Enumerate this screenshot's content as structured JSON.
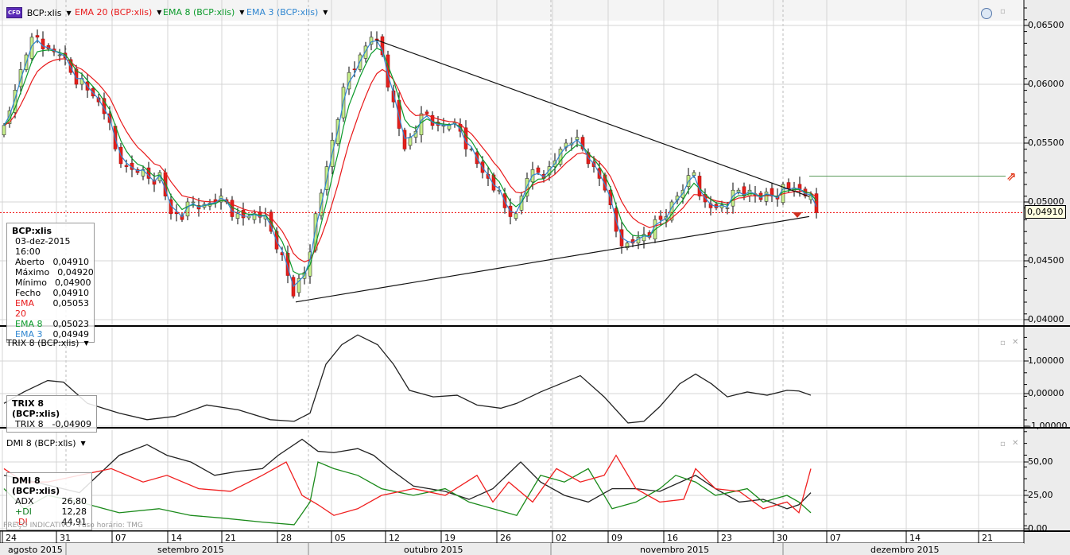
{
  "header": {
    "symbol_badge": "CFD",
    "symbol": "BCP:xlis",
    "indicators": [
      {
        "label": "EMA 20 (BCP:xlis)",
        "color": "#e8191a"
      },
      {
        "label": "EMA 8 (BCP:xlis)",
        "color": "#0a9a2a"
      },
      {
        "label": "EMA 3 (BCP:xlis)",
        "color": "#2f86d0"
      }
    ]
  },
  "info_box": {
    "title": "BCP:xlis",
    "datetime": "03-dez-2015 16:00",
    "rows": [
      {
        "label": "Aberto",
        "value": "0,04910",
        "color": "#000"
      },
      {
        "label": "Máximo",
        "value": "0,04920",
        "color": "#000"
      },
      {
        "label": "Mínimo",
        "value": "0,04900",
        "color": "#000"
      },
      {
        "label": "Fecho",
        "value": "0,04910",
        "color": "#000"
      },
      {
        "label": "EMA 20",
        "value": "0,05053",
        "color": "#e8191a"
      },
      {
        "label": "EMA 8",
        "value": "0,05023",
        "color": "#0a9a2a"
      },
      {
        "label": "EMA 3",
        "value": "0,04949",
        "color": "#2f86d0"
      }
    ]
  },
  "trix_panel": {
    "title": "TRIX 8 (BCP:xlis)",
    "box_title": "TRIX 8 (BCP:xlis)",
    "label": "TRIX 8",
    "value": "-0,04909"
  },
  "dmi_panel": {
    "title": "DMI 8 (BCP:xlis)",
    "box_title": "DMI 8 (BCP:xlis)",
    "rows": [
      {
        "label": "ADX",
        "value": "26,80",
        "color": "#000"
      },
      {
        "label": "+DI",
        "value": "12,28",
        "color": "#0a7a1a"
      },
      {
        "label": "-DI",
        "value": "44,91",
        "color": "#e8191a"
      }
    ]
  },
  "current_price_tag": "0,04910",
  "footer": {
    "indicative": "PREÇO INDICATIVO",
    "timezone": "Fuso horário: TMG"
  },
  "chart_data": [
    {
      "type": "candlestick",
      "title": "BCP:xlis",
      "x_unit": "days since 2015-08-24",
      "close_start_day": 0.2,
      "close_step_days": 1.4,
      "closes": [
        0.0565,
        0.0595,
        0.0625,
        0.064,
        0.063,
        0.0625,
        0.061,
        0.0605,
        0.059,
        0.0575,
        0.0545,
        0.053,
        0.0525,
        0.052,
        0.0525,
        0.049,
        0.0485,
        0.05,
        0.0498,
        0.05,
        0.05,
        0.049,
        0.0488,
        0.0487,
        0.0475,
        0.0455,
        0.042,
        0.044,
        0.049,
        0.053,
        0.057,
        0.061,
        0.0625,
        0.064,
        0.0625,
        0.0585,
        0.0545,
        0.056,
        0.0575,
        0.0565,
        0.0565,
        0.056,
        0.0545,
        0.0525,
        0.051,
        0.0495,
        0.049,
        0.052,
        0.0525,
        0.053,
        0.0545,
        0.055,
        0.0545,
        0.053,
        0.051,
        0.0475,
        0.0465,
        0.047,
        0.047,
        0.0485,
        0.05,
        0.051,
        0.0525,
        0.05,
        0.0495,
        0.0495,
        0.051,
        0.051,
        0.0502,
        0.0505,
        0.0515,
        0.0512,
        0.0505,
        0.0491
      ],
      "ylim": [
        0.0395,
        0.0675
      ],
      "y_ticks": [
        "0,04000",
        "0,04500",
        "0,05000",
        "0,05500",
        "0,06000",
        "0,06500"
      ],
      "y_tick_values": [
        0.04,
        0.045,
        0.05,
        0.055,
        0.06,
        0.065
      ],
      "current_price": 0.0491,
      "alert_level": 0.0522,
      "trendlines": [
        {
          "name": "upper",
          "from": [
            47.0,
            0.06378
          ],
          "to": [
            101.5,
            0.05046
          ]
        },
        {
          "name": "lower",
          "from": [
            36.9,
            0.0415
          ],
          "to": [
            101.5,
            0.04876
          ]
        }
      ],
      "ema_series": [
        "EMA 20",
        "EMA 8",
        "EMA 3"
      ]
    },
    {
      "type": "line",
      "title": "TRIX 8 (BCP:xlis)",
      "ylim": [
        -1.0,
        2.1
      ],
      "y_ticks": [
        "-1,00000",
        "0,00000",
        "1,00000"
      ],
      "y_tick_values": [
        -1,
        0,
        1
      ],
      "points": [
        [
          0.2,
          -0.3
        ],
        [
          2.7,
          0.05
        ],
        [
          5.7,
          0.4
        ],
        [
          7.7,
          0.35
        ],
        [
          10.7,
          -0.3
        ],
        [
          14.7,
          -0.6
        ],
        [
          18.2,
          -0.8
        ],
        [
          21.7,
          -0.7
        ],
        [
          25.7,
          -0.35
        ],
        [
          29.7,
          -0.5
        ],
        [
          33.7,
          -0.8
        ],
        [
          36.7,
          -0.85
        ],
        [
          38.7,
          -0.6
        ],
        [
          40.7,
          0.9
        ],
        [
          42.7,
          1.5
        ],
        [
          44.7,
          1.8
        ],
        [
          47.2,
          1.5
        ],
        [
          49.2,
          0.9
        ],
        [
          51.2,
          0.1
        ],
        [
          54.2,
          -0.1
        ],
        [
          57.2,
          -0.05
        ],
        [
          59.7,
          -0.35
        ],
        [
          62.7,
          -0.45
        ],
        [
          64.7,
          -0.3
        ],
        [
          67.7,
          0.05
        ],
        [
          70.2,
          0.3
        ],
        [
          72.7,
          0.55
        ],
        [
          75.7,
          -0.1
        ],
        [
          78.7,
          -0.9
        ],
        [
          80.7,
          -0.85
        ],
        [
          82.7,
          -0.4
        ],
        [
          85.2,
          0.3
        ],
        [
          87.2,
          0.6
        ],
        [
          89.2,
          0.3
        ],
        [
          91.2,
          -0.1
        ],
        [
          93.7,
          0.05
        ],
        [
          96.2,
          -0.05
        ],
        [
          98.7,
          0.1
        ],
        [
          100.2,
          0.08
        ],
        [
          101.7,
          -0.05
        ]
      ]
    },
    {
      "type": "line",
      "title": "DMI 8 (BCP:xlis)",
      "ylim": [
        0,
        75
      ],
      "y_ticks": [
        "0,00",
        "25,00",
        "50,00"
      ],
      "y_tick_values": [
        0,
        25,
        50
      ],
      "series": [
        {
          "name": "ADX",
          "color": "#222222",
          "points": [
            [
              0.2,
              40
            ],
            [
              2.7,
              37
            ],
            [
              9.7,
              27
            ],
            [
              14.7,
              55
            ],
            [
              18.2,
              63
            ],
            [
              20.7,
              55
            ],
            [
              23.7,
              50
            ],
            [
              26.7,
              40
            ],
            [
              29.7,
              43
            ],
            [
              32.7,
              45
            ],
            [
              34.7,
              55
            ],
            [
              37.7,
              67
            ],
            [
              39.7,
              58
            ],
            [
              41.7,
              57
            ],
            [
              44.7,
              60
            ],
            [
              46.7,
              55
            ],
            [
              48.7,
              45
            ],
            [
              51.7,
              32
            ],
            [
              55.7,
              28
            ],
            [
              58.7,
              22
            ],
            [
              61.7,
              30
            ],
            [
              65.2,
              50
            ],
            [
              67.7,
              35
            ],
            [
              70.7,
              25
            ],
            [
              73.7,
              20
            ],
            [
              76.7,
              30
            ],
            [
              79.7,
              30
            ],
            [
              82.7,
              28
            ],
            [
              87.2,
              40
            ],
            [
              89.7,
              30
            ],
            [
              92.7,
              20
            ],
            [
              95.7,
              22
            ],
            [
              98.7,
              15
            ],
            [
              100.2,
              18
            ],
            [
              101.7,
              27
            ]
          ]
        },
        {
          "name": "+DI",
          "color": "#1a8a1a",
          "points": [
            [
              0.2,
              30
            ],
            [
              2.7,
              15
            ],
            [
              5.7,
              25
            ],
            [
              9.7,
              20
            ],
            [
              14.7,
              12
            ],
            [
              19.7,
              15
            ],
            [
              23.7,
              10
            ],
            [
              27.7,
              8
            ],
            [
              32.7,
              5
            ],
            [
              36.7,
              3
            ],
            [
              38.7,
              20
            ],
            [
              39.7,
              50
            ],
            [
              41.7,
              45
            ],
            [
              44.7,
              40
            ],
            [
              47.7,
              30
            ],
            [
              51.7,
              25
            ],
            [
              55.7,
              30
            ],
            [
              58.7,
              20
            ],
            [
              61.7,
              15
            ],
            [
              64.7,
              10
            ],
            [
              67.7,
              40
            ],
            [
              70.7,
              35
            ],
            [
              73.7,
              45
            ],
            [
              76.7,
              15
            ],
            [
              79.7,
              20
            ],
            [
              82.7,
              30
            ],
            [
              84.7,
              40
            ],
            [
              87.2,
              35
            ],
            [
              89.7,
              25
            ],
            [
              93.7,
              30
            ],
            [
              95.7,
              20
            ],
            [
              98.7,
              25
            ],
            [
              100.2,
              20
            ],
            [
              101.7,
              12
            ]
          ]
        },
        {
          "name": "-DI",
          "color": "#f02020",
          "points": [
            [
              0.2,
              45
            ],
            [
              2.7,
              35
            ],
            [
              5.7,
              35
            ],
            [
              9.7,
              40
            ],
            [
              13.7,
              45
            ],
            [
              17.7,
              35
            ],
            [
              20.7,
              40
            ],
            [
              24.7,
              30
            ],
            [
              28.7,
              28
            ],
            [
              32.7,
              40
            ],
            [
              35.7,
              50
            ],
            [
              37.7,
              25
            ],
            [
              39.7,
              18
            ],
            [
              41.7,
              10
            ],
            [
              44.7,
              15
            ],
            [
              47.7,
              25
            ],
            [
              51.7,
              30
            ],
            [
              55.7,
              25
            ],
            [
              59.7,
              40
            ],
            [
              61.7,
              20
            ],
            [
              63.7,
              35
            ],
            [
              66.7,
              20
            ],
            [
              69.7,
              45
            ],
            [
              72.7,
              35
            ],
            [
              75.7,
              40
            ],
            [
              77.2,
              55
            ],
            [
              79.7,
              30
            ],
            [
              82.7,
              20
            ],
            [
              85.7,
              22
            ],
            [
              87.2,
              45
            ],
            [
              89.7,
              30
            ],
            [
              92.7,
              28
            ],
            [
              95.7,
              15
            ],
            [
              98.7,
              20
            ],
            [
              100.2,
              12
            ],
            [
              101.7,
              45
            ]
          ]
        }
      ]
    }
  ],
  "date_axis": {
    "days": [
      "24",
      "31",
      "07",
      "14",
      "21",
      "28",
      "05",
      "12",
      "19",
      "26",
      "02",
      "09",
      "16",
      "23",
      "30",
      "07",
      "14",
      "21"
    ],
    "months": [
      "agosto 2015",
      "setembro 2015",
      "outubro 2015",
      "novembro 2015",
      "dezembro 2015"
    ]
  }
}
